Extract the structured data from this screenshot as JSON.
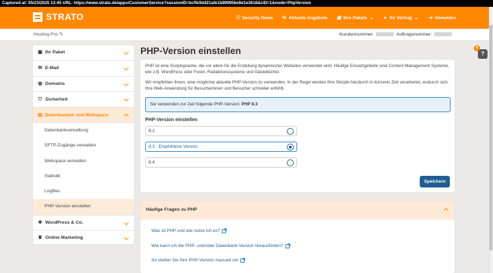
{
  "capture": {
    "text": "Captured at: 05/23/2025 13:45    URL: https://www.strato.de/apps/CustomerService?sessionID=bcffe9d421afe1b899956e9e1e3618&cID=1&node=PhpVersion"
  },
  "brand": {
    "logo_text": "STRATO",
    "accent_color": "#ff8800",
    "primary_color": "#1f5f92"
  },
  "topnav": {
    "items": [
      {
        "label": "Security Deals",
        "icon": "shield-icon"
      },
      {
        "label": "Aktuelle Angebote",
        "icon": "percent-icon"
      },
      {
        "label": "Ihre Pakete",
        "icon": "box-icon"
      },
      {
        "label": "Ihr Vertrag",
        "icon": "user-icon"
      },
      {
        "label": "Abmelden",
        "icon": "logout-icon"
      }
    ]
  },
  "subheader": {
    "package": "Hosting Pro",
    "customer_label": "Kundennummer:",
    "order_label": "Auftragsnummer:"
  },
  "sidebar": {
    "items": [
      {
        "label": "Ihr Paket",
        "icon": "box-icon"
      },
      {
        "label": "E-Mail",
        "icon": "mail-icon"
      },
      {
        "label": "Domains",
        "icon": "globe-icon"
      },
      {
        "label": "Sicherheit",
        "icon": "shield-icon"
      },
      {
        "label": "Datenbanken und Webspace",
        "icon": "database-icon"
      }
    ],
    "subitems": [
      "Datenbankverwaltung",
      "SFTP-Zugänge verwalten",
      "Webspace verwalten",
      "Statistik",
      "Logfiles",
      "PHP-Version einstellen"
    ],
    "bottom_items": [
      {
        "label": "WordPress & Co.",
        "icon": "wordpress-icon"
      },
      {
        "label": "Online Marketing",
        "icon": "trophy-icon"
      }
    ]
  },
  "main": {
    "title": "PHP-Version einstellen",
    "intro1": "PHP ist eine Scriptsprache, die vor allem für die Erstellung dynamischer Websites verwendet wird. Häufige Einsatzgebiete sind Content Management Systeme, wie z.B. WordPress oder Foren, Redaktionssysteme und Gästebücher.",
    "intro2": "Wir empfehlen Ihnen, eine möglichst aktuelle PHP-Version zu verwenden. In der Regel werden Ihre Skripte hierdurch in kürzerer Zeit verarbeitet, wodurch sich Ihre Web-Anwendung für Besucherinnen und Besucher schneller anfühlt.",
    "notice_prefix": "Sie verwenden zur Zeit folgende PHP-Version:",
    "notice_version": "PHP 8.3",
    "section_title": "PHP-Version einstellen",
    "options": [
      "8.2",
      "8.3 - Empfohlene Version",
      "8.4"
    ],
    "selected_option": "8.3 - Empfohlene Version",
    "save_label": "Speichern"
  },
  "faq": {
    "title": "Häufige Fragen zu PHP",
    "links": [
      "Was ist PHP und wie nutze ich es?",
      "Wie kann ich die PHP- und/oder Datenbank-Version herausfinden?",
      "So stellen Sie Ihre PHP-Version manuell um"
    ]
  },
  "help": {
    "badge_count": "6",
    "label": "?"
  }
}
